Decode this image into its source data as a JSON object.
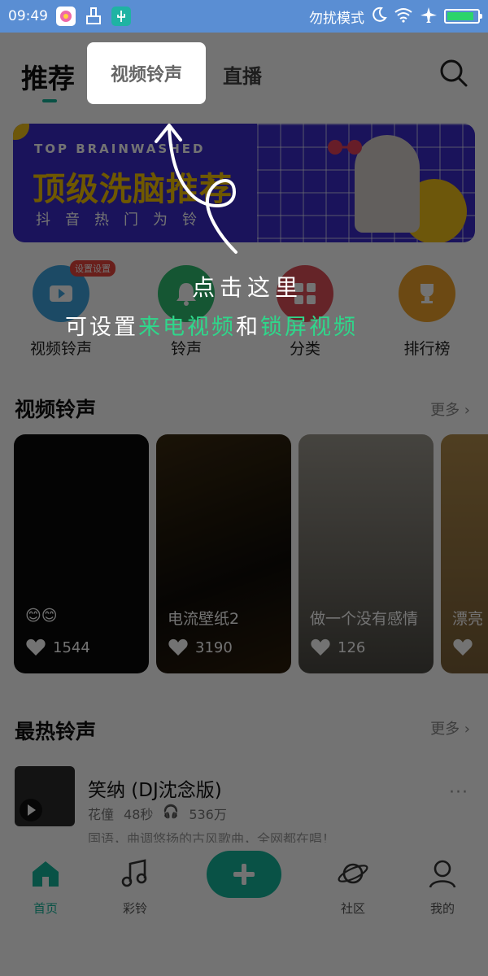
{
  "status_bar": {
    "time": "09:49",
    "dnd_label": "勿扰模式",
    "battery_level": 0.9,
    "battery_color": "#2bd46b"
  },
  "top_tabs": {
    "recommend": "推荐",
    "video_ringtone": "视频铃声",
    "live": "直播"
  },
  "banner": {
    "english": "TOP BRAINWASHED",
    "headline": "顶级洗脑推荐",
    "sub": "抖音热门为铃"
  },
  "categories": [
    {
      "label": "视频铃声",
      "badge": "设置设置",
      "color": "#3ea4e0",
      "icon": "play-icon"
    },
    {
      "label": "铃声",
      "color": "#2fbf71",
      "icon": "bell-icon"
    },
    {
      "label": "分类",
      "color": "#e0505a",
      "icon": "category-icon"
    },
    {
      "label": "排行榜",
      "color": "#f0a32b",
      "icon": "trophy-icon"
    }
  ],
  "video_section": {
    "title": "视频铃声",
    "more": "更多 ›",
    "cards": [
      {
        "title": "😊😊",
        "likes": "1544"
      },
      {
        "title": "电流壁纸2",
        "likes": "3190"
      },
      {
        "title": "做一个没有感情",
        "likes": "126"
      },
      {
        "title": "漂亮",
        "likes": ""
      }
    ]
  },
  "hot_section": {
    "title": "最热铃声",
    "more": "更多 ›",
    "song": {
      "name": "笑纳 (DJ沈念版)",
      "artist": "花僮",
      "duration": "48秒",
      "plays": "536万",
      "desc": "国语，曲调悠扬的古风歌曲，全网都在唱！"
    }
  },
  "bottom_nav": [
    {
      "label": "首页",
      "icon": "home-icon"
    },
    {
      "label": "彩铃",
      "icon": "music-note-icon"
    },
    {
      "label": "社区",
      "icon": "planet-icon"
    },
    {
      "label": "我的",
      "icon": "person-icon"
    }
  ],
  "guide": {
    "line1": "点击这里",
    "line2_white": "可设置",
    "line2_green_a": "来电视频",
    "line2_mid": "和",
    "line2_green_b": "锁屏视频"
  },
  "colors": {
    "accent": "#14b79b",
    "status_bar": "#5a8ed3",
    "banner_bg": "#3b2cc9",
    "banner_yellow": "#f5c400"
  }
}
